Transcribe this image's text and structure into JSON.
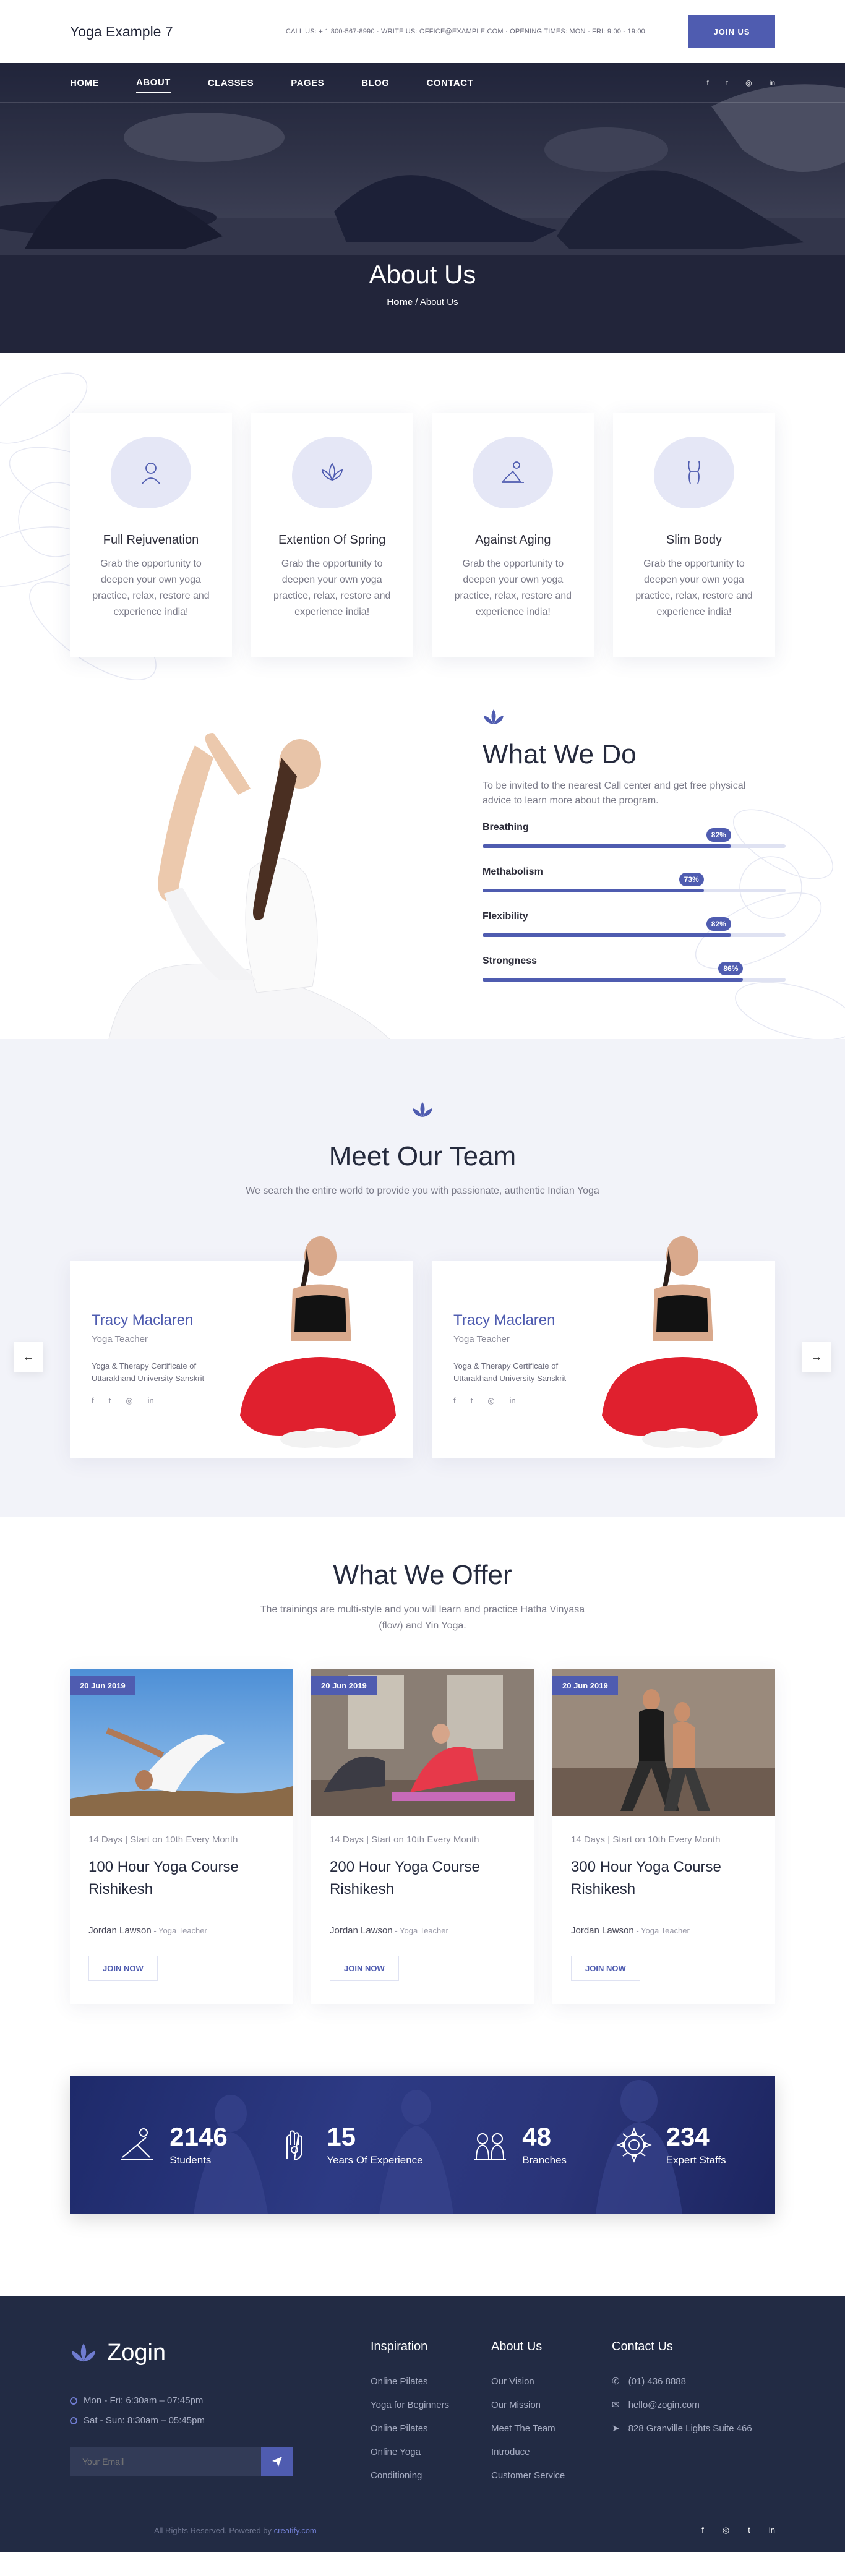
{
  "header": {
    "logo": "Yoga Example 7",
    "info": "CALL US: + 1 800-567-8990 · WRITE US: OFFICE@EXAMPLE.COM · OPENING TIMES: MON - FRI: 9:00 - 19:00",
    "join_label": "JOIN US"
  },
  "nav": {
    "items": [
      {
        "label": "HOME"
      },
      {
        "label": "ABOUT"
      },
      {
        "label": "CLASSES"
      },
      {
        "label": "PAGES"
      },
      {
        "label": "BLOG"
      },
      {
        "label": "CONTACT"
      }
    ],
    "socials": [
      "f",
      "t",
      "◎",
      "in"
    ]
  },
  "hero": {
    "title": "About Us",
    "crumb_home": "Home",
    "crumb_sep": " / ",
    "crumb_current": "About Us"
  },
  "features": [
    {
      "icon": "face-icon",
      "title": "Full Rejuvenation",
      "desc": "Grab the opportunity to deepen your own yoga practice, relax, restore and experience india!"
    },
    {
      "icon": "lotus-icon",
      "title": "Extention Of Spring",
      "desc": "Grab the opportunity to deepen your own yoga practice, relax, restore and experience india!"
    },
    {
      "icon": "stretch-icon",
      "title": "Against Aging",
      "desc": "Grab the opportunity to deepen your own yoga practice, relax, restore and experience india!"
    },
    {
      "icon": "body-icon",
      "title": "Slim Body",
      "desc": "Grab the opportunity to deepen your own yoga practice, relax, restore and experience india!"
    }
  ],
  "what_we_do": {
    "title": "What We Do",
    "desc": "To be invited to the nearest Call center and get free physical advice to learn more about the program.",
    "skills": [
      {
        "label": "Breathing",
        "value": 82,
        "text": "82%"
      },
      {
        "label": "Methabolism",
        "value": 73,
        "text": "73%"
      },
      {
        "label": "Flexibility",
        "value": 82,
        "text": "82%"
      },
      {
        "label": "Strongness",
        "value": 86,
        "text": "86%"
      }
    ]
  },
  "team": {
    "title": "Meet Our Team",
    "subtitle": "We search the entire world to provide you with passionate, authentic Indian Yoga",
    "prev": "←",
    "next": "→",
    "members": [
      {
        "name": "Tracy Maclaren",
        "role": "Yoga Teacher",
        "desc": "Yoga & Therapy Certificate of Uttarakhand University Sanskrit"
      },
      {
        "name": "Tracy Maclaren",
        "role": "Yoga Teacher",
        "desc": "Yoga & Therapy Certificate of Uttarakhand University Sanskrit"
      }
    ],
    "member_socials": [
      "f",
      "t",
      "◎",
      "in"
    ]
  },
  "offer": {
    "title": "What We Offer",
    "subtitle": "The trainings are multi-style and you will learn and practice Hatha Vinyasa (flow) and Yin Yoga.",
    "courses": [
      {
        "date": "20 Jun 2019",
        "meta": "14 Days | Start on 10th Every Month",
        "title": "100 Hour Yoga Course Rishikesh",
        "author": "Jordan Lawson",
        "author_role": " - Yoga Teacher",
        "button": "JOIN NOW"
      },
      {
        "date": "20 Jun 2019",
        "meta": "14 Days | Start on 10th Every Month",
        "title": "200 Hour Yoga Course Rishikesh",
        "author": "Jordan Lawson",
        "author_role": " - Yoga Teacher",
        "button": "JOIN NOW"
      },
      {
        "date": "20 Jun 2019",
        "meta": "14 Days | Start on 10th Every Month",
        "title": "300 Hour Yoga Course Rishikesh",
        "author": "Jordan Lawson",
        "author_role": " - Yoga Teacher",
        "button": "JOIN NOW"
      }
    ]
  },
  "stats": [
    {
      "icon": "pose-icon",
      "number": "2146",
      "label": "Students"
    },
    {
      "icon": "hand-icon",
      "number": "15",
      "label": "Years Of Experience"
    },
    {
      "icon": "branches-icon",
      "number": "48",
      "label": "Branches"
    },
    {
      "icon": "mandala-icon",
      "number": "234",
      "label": "Expert Staffs"
    }
  ],
  "footer": {
    "brand": "Zogin",
    "hours": [
      "Mon - Fri: 6:30am – 07:45pm",
      "Sat - Sun: 8:30am – 05:45pm"
    ],
    "email_placeholder": "Your Email",
    "columns": [
      {
        "title": "Inspiration",
        "links": [
          "Online Pilates",
          "Yoga for Beginners",
          "Online Pilates",
          "Online Yoga",
          "Conditioning"
        ]
      },
      {
        "title": "About Us",
        "links": [
          "Our Vision",
          "Our Mission",
          "Meet The Team",
          "Introduce",
          "Customer Service"
        ]
      }
    ],
    "contact": {
      "title": "Contact Us",
      "phone": "(01) 436 8888",
      "email": "hello@zogin.com",
      "address": "828 Granville Lights Suite 466"
    },
    "copyright": "All Rights Reserved. Powered by ",
    "copyright_link": "creatify.com",
    "socials": [
      "f",
      "◎",
      "t",
      "in"
    ]
  },
  "colors": {
    "accent": "#4f5cb0",
    "footer_bg": "#222b44",
    "team_bg": "#f2f3f9"
  }
}
